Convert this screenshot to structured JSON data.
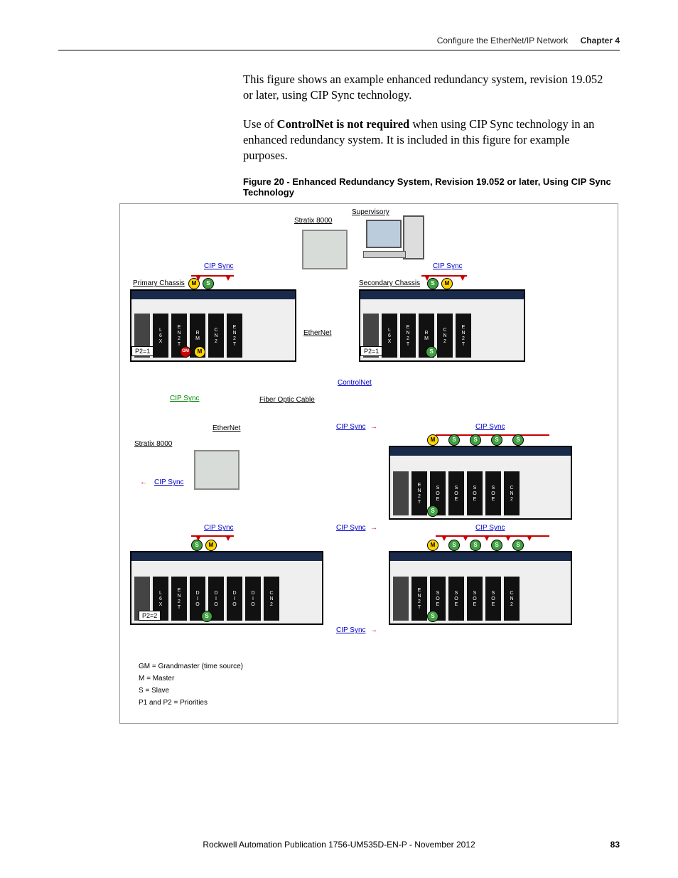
{
  "header": {
    "section": "Configure the EtherNet/IP Network",
    "chapter": "Chapter 4"
  },
  "paragraphs": {
    "p1": "This figure shows an example enhanced redundancy system, revision 19.052 or later, using CIP Sync technology.",
    "p2a": "Use of ",
    "p2b": "ControlNet is not required",
    "p2c": " when using CIP Sync technology in an enhanced redundancy system. It is included in this figure for example purposes."
  },
  "figure": {
    "caption": "Figure 20 - Enhanced Redundancy System, Revision 19.052 or later, Using CIP Sync Technology",
    "labels": {
      "supervisory": "Supervisory",
      "stratix_top": "Stratix 8000",
      "stratix_left": "Stratix 8000",
      "primary": "Primary Chassis",
      "secondary": "Secondary Chassis",
      "ethernet1": "EtherNet",
      "ethernet2": "EtherNet",
      "controlnet": "ControlNet",
      "fiber": "Fiber Optic Cable",
      "p2_1a": "P2=1",
      "p2_1b": "P2=1",
      "p2_2": "P2=2",
      "cip_sync": "CIP Sync"
    },
    "nodes": {
      "gm": "GM",
      "m": "M",
      "s": "S"
    },
    "slot_names": {
      "l6x": "L6X",
      "en2t": "EN2T",
      "rm": "RM",
      "cn2": "CN2",
      "dio": "DIO",
      "soe": "SOE"
    },
    "legend": {
      "gm": "GM = Grandmaster (time source)",
      "m": "M = Master",
      "s": "S = Slave",
      "p": "P1 and P2 = Priorities"
    }
  },
  "footer": {
    "pub": "Rockwell Automation Publication 1756-UM535D-EN-P - November 2012",
    "page": "83"
  }
}
